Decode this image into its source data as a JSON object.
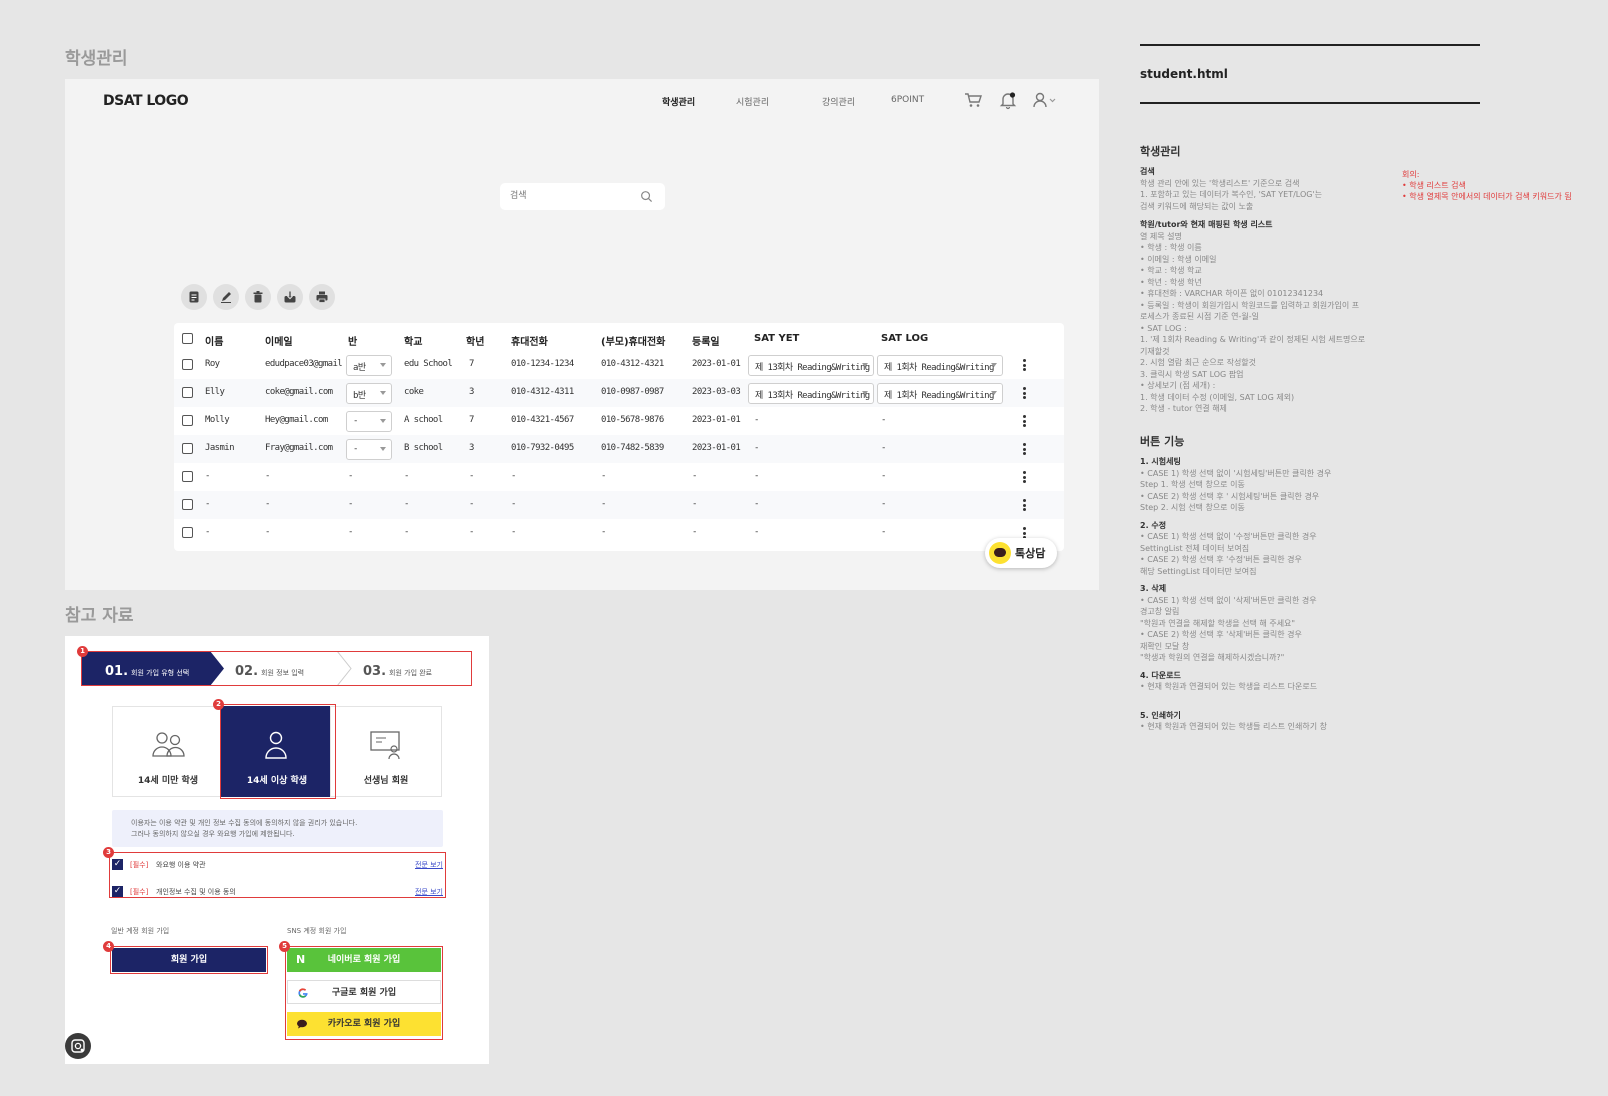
{
  "titles": {
    "main": "학생관리",
    "ref": "참고 자료"
  },
  "header": {
    "logo": "DSAT LOGO",
    "nav": [
      "학생관리",
      "시험관리",
      "강의관리",
      "6POINT"
    ]
  },
  "search": {
    "placeholder": "검색"
  },
  "table": {
    "columns": [
      "이름",
      "이메일",
      "반",
      "학교",
      "학년",
      "휴대전화",
      "(부모)휴대전화",
      "등록일",
      "SAT YET",
      "SAT LOG"
    ],
    "rows": [
      {
        "name": "Roy",
        "email": "edudpace03@gmail",
        "class": "a반",
        "school": "edu School",
        "grade": "7",
        "phone": "010-1234-1234",
        "parent": "010-4312-4321",
        "date": "2023-01-01",
        "yet": "제 13회차 Reading&Writing",
        "log": "제 1회차 Reading&Writing"
      },
      {
        "name": "Elly",
        "email": "coke@gmail.com",
        "class": "b반",
        "school": "coke",
        "grade": "3",
        "phone": "010-4312-4311",
        "parent": "010-0987-0987",
        "date": "2023-03-03",
        "yet": "제 13회차 Reading&Writing",
        "log": "제 1회차 Reading&Writing"
      },
      {
        "name": "Molly",
        "email": "Hey@gmail.com",
        "class": "-",
        "school": "A school",
        "grade": "7",
        "phone": "010-4321-4567",
        "parent": "010-5678-9876",
        "date": "2023-01-01",
        "yet": "-",
        "log": "-"
      },
      {
        "name": "Jasmin",
        "email": "Fray@gmail.com",
        "class": "-",
        "school": "B school",
        "grade": "3",
        "phone": "010-7932-0495",
        "parent": "010-7482-5839",
        "date": "2023-01-01",
        "yet": "-",
        "log": "-"
      },
      {
        "name": "-",
        "email": "-",
        "class": "-",
        "school": "-",
        "grade": "-",
        "phone": "-",
        "parent": "-",
        "date": "-",
        "yet": "-",
        "log": "-"
      },
      {
        "name": "-",
        "email": "-",
        "class": "-",
        "school": "-",
        "grade": "-",
        "phone": "-",
        "parent": "-",
        "date": "-",
        "yet": "-",
        "log": "-"
      },
      {
        "name": "-",
        "email": "-",
        "class": "-",
        "school": "-",
        "grade": "-",
        "phone": "-",
        "parent": "-",
        "date": "-",
        "yet": "-",
        "log": "-"
      }
    ]
  },
  "chat": {
    "label": "톡상담"
  },
  "signup": {
    "steps": [
      {
        "num": "01.",
        "label": "회원 가입 유형 선택"
      },
      {
        "num": "02.",
        "label": "회원 정보 입력"
      },
      {
        "num": "03.",
        "label": "회원 가입 완료"
      }
    ],
    "badges": [
      "1",
      "2",
      "3",
      "4",
      "5"
    ],
    "cards": [
      "14세 미만 학생",
      "14세 이상 학생",
      "선생님 회원"
    ],
    "notice": [
      "이용자는 이용 약관 및 개인 정보 수집 동의에 동의하지 않을 권리가 있습니다.",
      "그러나 동의하지 않으실 경우 와요행 가입에 제한됩니다."
    ],
    "agreements": [
      {
        "req": "[필수]",
        "title": "와요행 이용 약관",
        "more": "전문 보기"
      },
      {
        "req": "[필수]",
        "title": "개인정보 수집 및 이용 동의",
        "more": "전문 보기"
      }
    ],
    "general_label": "일반 계정 회원 가입",
    "sns_label": "SNS 계정 회원 가입",
    "join_btn": "회원 가입",
    "naver_btn": "네이버로 회원 가입",
    "google_btn": "구글로 회원 가입",
    "kakao_btn": "카카오로 회원 가입"
  },
  "doc": {
    "filename": "student.html",
    "heading": "학생관리",
    "search_title": "검색",
    "search_lines": [
      "학생 관리 안에 있는 '학생리스트' 기준으로 검색",
      "1. 포함하고 있는 데이터가 복수인, 'SAT YET/LOG'는",
      "    검색 키워드에 해당되는 값이 노출"
    ],
    "list_title": "학원/tutor와 현재 매핑된 학생 리스트",
    "list_lines": [
      "열 제목 설명",
      "• 학생 : 학생 이름",
      "• 이메일 : 학생 이메일",
      "• 학교 : 학생 학교",
      "• 학년 : 학생 학년",
      "• 휴대전화 : VARCHAR 하이픈 없이 01012341234",
      "• 등록일 : 학생이 회원가입시 학원코드를 입력하고 회원가입이 프",
      "   로세스가 종료된 시점 기준 연-월-일",
      "• SAT LOG :",
      "   1. '제 1회차 Reading & Writing'과 같이 정제된 시험 세트명으로",
      "   기재할것",
      "   2. 시험 열람 최근 순으로 작성할것",
      "   3. 클릭시 학생 SAT LOG 팝업",
      "• 상세보기 (점 세개) :",
      "   1. 학생 데이터 수정 (이메일, SAT LOG 제외)",
      "   2. 학생 - tutor 연결 해제"
    ],
    "memo_title": "회의:",
    "memo_lines": [
      "• 학생 리스트 검색",
      "• 학생 열제목 안에서의 데이터가 검색 키워드가 됨"
    ],
    "btn_heading": "버튼 기능",
    "btn1_title": "1. 시험세팅",
    "btn1_lines": [
      "• CASE 1) 학생 선택 없이 '시험세팅'버튼만 클릭한 경우",
      "   Step 1. 학생 선택 창으로 이동",
      "• CASE 2) 학생 선택 후 ' 시험세팅'버튼 클릭한 경우",
      "   Step 2. 시험 선택 창으로 이동"
    ],
    "btn2_title": "2. 수정",
    "btn2_lines": [
      "• CASE 1) 학생 선택 없이 '수정'버튼만 클릭한 경우",
      "   SettingList 전체 데이터 보여짐",
      "• CASE 2) 학생 선택 후 '수정'버튼 클릭한 경우",
      "   해당 SettingList 데이터만 보여짐"
    ],
    "btn3_title": "3. 삭제",
    "btn3_lines": [
      "• CASE 1) 학생 선택 없이 '삭제'버튼만 클릭한 경우",
      "   경고창 알림",
      "   \"학원과 연결을 해제할 학생을 선택 해 주세요\"",
      "• CASE 2) 학생 선택 후 '삭제'버튼 클릭한 경우",
      "   재확인 모달 창",
      "   \"학생과 학원의 연결을 해제하시겠습니까?\""
    ],
    "btn4_title": "4. 다운로드",
    "btn4_lines": [
      "• 현재 학원과 연결되어 있는 학생을 리스트 다운로드"
    ],
    "btn5_title": "5. 인쇄하기",
    "btn5_lines": [
      "• 현재 학원과 연결되어 있는 학생들 리스트 인쇄하기 창"
    ]
  },
  "colors": {
    "navy": "#1c2466",
    "naver": "#59c33b",
    "kakao": "#fde131",
    "red": "#e03b3b"
  }
}
